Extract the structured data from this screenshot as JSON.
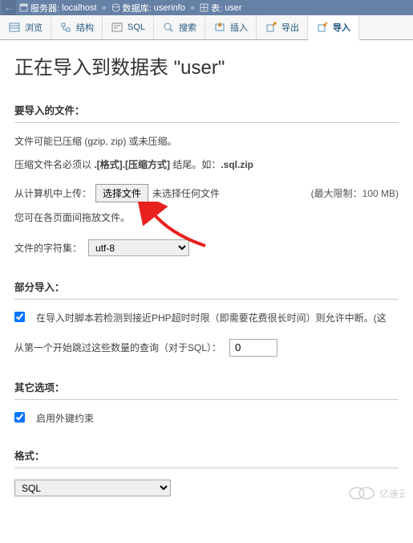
{
  "breadcrumb": {
    "server_label": "服务器:",
    "server_value": "localhost",
    "db_label": "数据库:",
    "db_value": "userinfo",
    "table_label": "表:",
    "table_value": "user"
  },
  "tabs": {
    "browse": "浏览",
    "structure": "结构",
    "sql": "SQL",
    "search": "搜索",
    "insert": "插入",
    "export": "导出",
    "import": "导入"
  },
  "heading": "正在导入到数据表 \"user\"",
  "section_file": {
    "title": "要导入的文件：",
    "compress_line": "文件可能已压缩 (gzip, zip) 或未压缩。",
    "name_prefix": "压缩文件名必须以 ",
    "name_format": ".[格式].[压缩方式]",
    "name_mid": " 结尾。如：",
    "name_example": ".sql.zip",
    "upload_label": "从计算机中上传：",
    "choose_btn": "选择文件",
    "no_file": "未选择任何文件",
    "max_limit": "(最大限制：100 MB)",
    "drag_hint": "您可在各页面间拖放文件。",
    "charset_label": "文件的字符集：",
    "charset_value": "utf-8"
  },
  "section_partial": {
    "title": "部分导入：",
    "checkbox_label": "在导入时脚本若检测到接近PHP超时时限（即需要花费很长时间）则允许中断。(这",
    "skip_label": "从第一个开始跳过这些数量的查询（对于SQL）：",
    "skip_value": "0"
  },
  "section_other": {
    "title": "其它选项：",
    "fk_label": "启用外键约束"
  },
  "section_format": {
    "title": "格式：",
    "value": "SQL"
  },
  "watermark": "亿速云"
}
